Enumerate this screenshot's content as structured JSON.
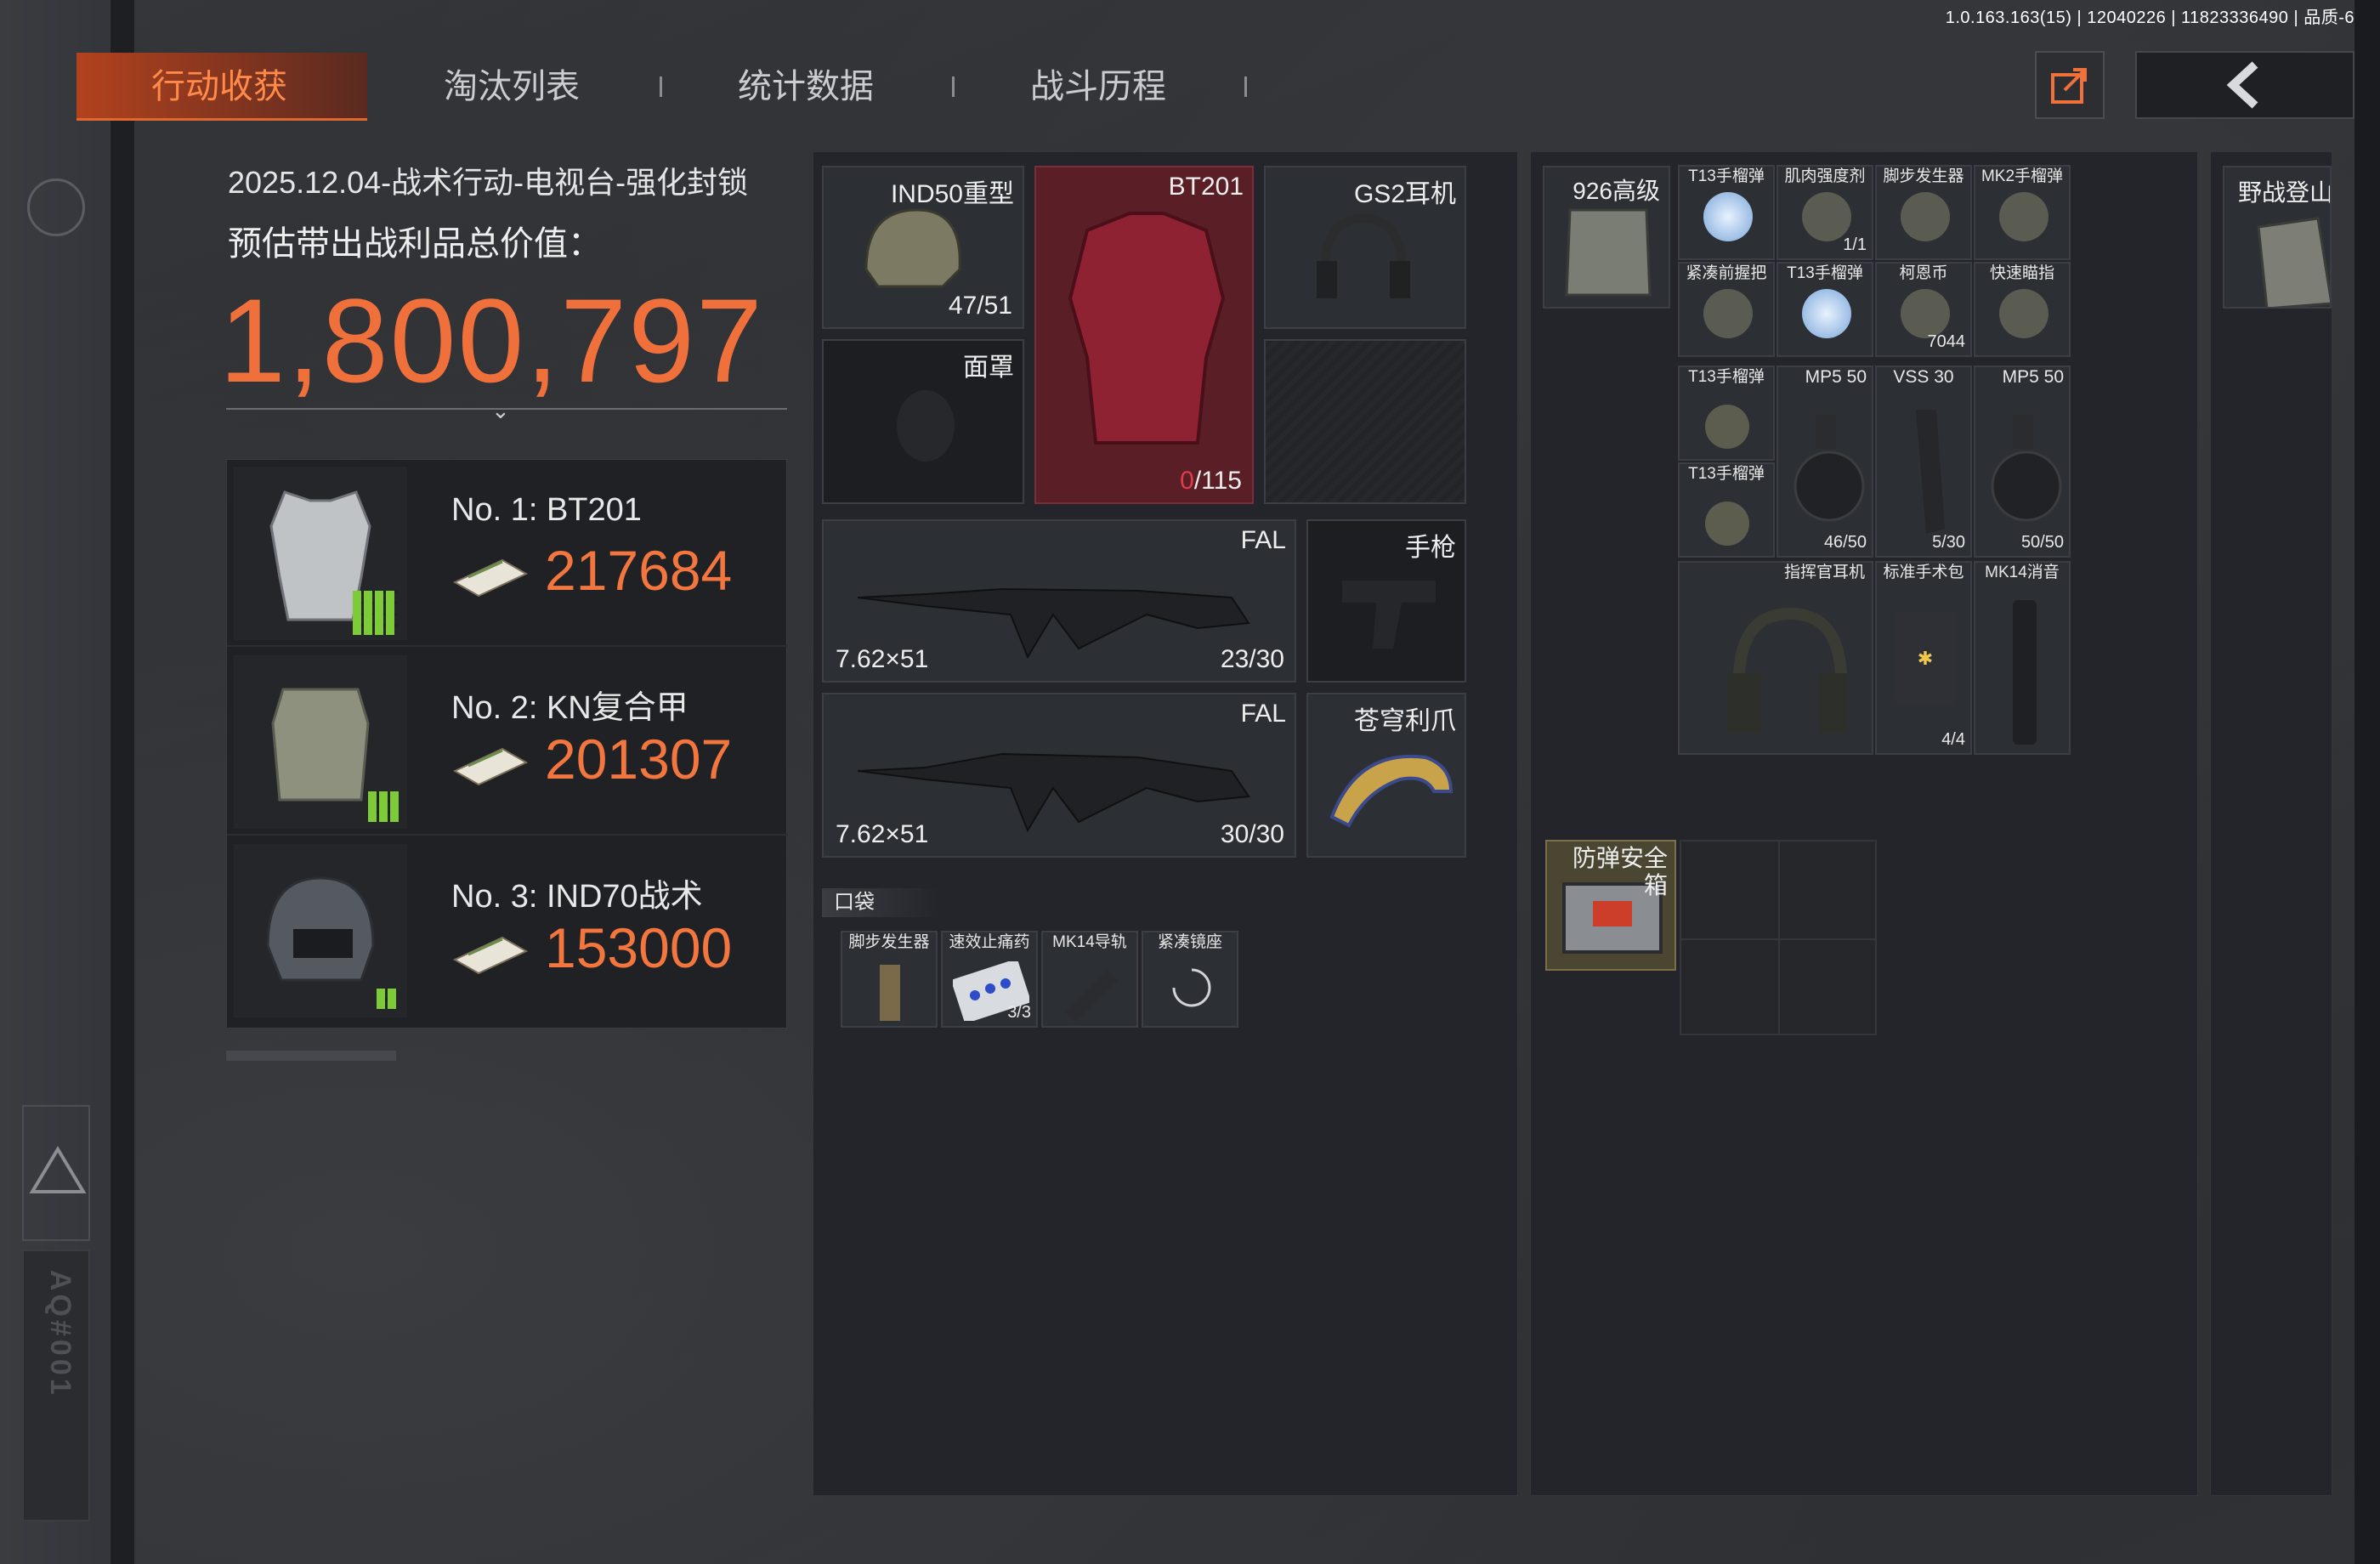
{
  "version": "1.0.163.163(15) | 12040226 | 11823336490 | 品质-6",
  "tabs": [
    "行动收获",
    "淘汰列表",
    "统计数据",
    "战斗历程"
  ],
  "summary": {
    "date": "2025.12.04-战术行动-电视台-强化封锁",
    "label": "预估带出战利品总价值：",
    "total": "1,800,797"
  },
  "top_items": [
    {
      "rank": "No. 1: BT201",
      "value": "217684"
    },
    {
      "rank": "No. 2: KN复合甲",
      "value": "201307"
    },
    {
      "rank": "No. 3: IND70战术",
      "value": "153000"
    }
  ],
  "equipment": {
    "helmet": {
      "name": "IND50重型",
      "count": "47/51"
    },
    "armor": {
      "name": "BT201",
      "count_cur": "0",
      "count_max": "/115"
    },
    "headset": {
      "name": "GS2耳机"
    },
    "mask": {
      "name": "面罩"
    },
    "primary1": {
      "name": "FAL",
      "caliber": "7.62×51",
      "ammo": "23/30"
    },
    "pistol": {
      "name": "手枪"
    },
    "primary2": {
      "name": "FAL",
      "caliber": "7.62×51",
      "ammo": "30/30"
    },
    "melee": {
      "name": "苍穹利爪"
    },
    "pocket_label": "口袋",
    "pockets": [
      {
        "name": "脚步发生器",
        "count": ""
      },
      {
        "name": "速效止痛药",
        "count": "3/3"
      },
      {
        "name": "MK14导轨",
        "count": ""
      },
      {
        "name": "紧凑镜座",
        "count": ""
      }
    ]
  },
  "rig": {
    "name": "926高级"
  },
  "rig_items": [
    {
      "name": "T13手榴弹",
      "count": ""
    },
    {
      "name": "肌肉强度剂",
      "count": "1/1"
    },
    {
      "name": "脚步发生器",
      "count": ""
    },
    {
      "name": "MK2手榴弹",
      "count": ""
    },
    {
      "name": "紧凑前握把",
      "count": ""
    },
    {
      "name": "T13手榴弹",
      "count": ""
    },
    {
      "name": "柯恩币",
      "count": "7044"
    },
    {
      "name": "快速瞄指",
      "count": ""
    }
  ],
  "mags": [
    {
      "name": "T13手榴弹",
      "count": ""
    },
    {
      "name": "MP5 50",
      "count": "46/50"
    },
    {
      "name": "VSS 30",
      "count": "5/30"
    },
    {
      "name": "MP5 50",
      "count": "50/50"
    },
    {
      "name": "T13手榴弹",
      "count": ""
    }
  ],
  "big_items": [
    {
      "name": "指挥官耳机",
      "count": ""
    },
    {
      "name": "标准手术包",
      "count": "4/4"
    },
    {
      "name": "MK14消音",
      "count": ""
    }
  ],
  "safe_box": {
    "name": "防弹安全箱"
  },
  "backpack": {
    "name": "野战登山包"
  },
  "side_text": "AQ#001",
  "colors": {
    "accent": "#f0703c",
    "panel": "#23252a",
    "active_tab": "#b2421e",
    "green_grid": "#7ecb3a"
  }
}
